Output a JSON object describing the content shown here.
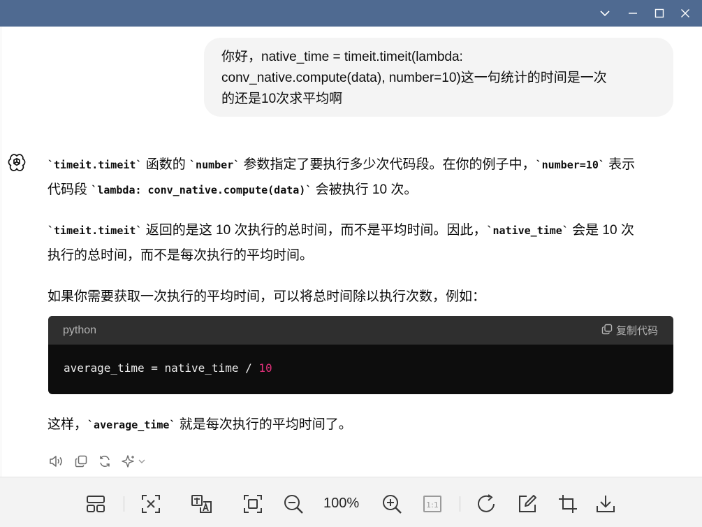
{
  "window": {
    "controls": [
      "chevron-down-icon",
      "minimize-icon",
      "maximize-icon",
      "close-icon"
    ]
  },
  "user_message": {
    "line1": "你好，native_time = timeit.timeit(lambda:",
    "line2": "conv_native.compute(data), number=10)这一句统计的时间是一次",
    "line3": "的还是10次求平均啊"
  },
  "assistant": {
    "p1": {
      "code1": "`timeit.timeit`",
      "t1": " 函数的 ",
      "code2": "`number`",
      "t2": " 参数指定了要执行多少次代码段。在你的例子中，",
      "code3": "`number=10`",
      "t3": " 表示",
      "t4": "代码段 ",
      "code4": "`lambda: conv_native.compute(data)`",
      "t5": " 会被执行 10 次。"
    },
    "p2": {
      "code1": "`timeit.timeit`",
      "t1": " 返回的是这 10 次执行的总时间，而不是平均时间。因此，",
      "code2": "`native_time`",
      "t2": " 会是 10 次",
      "t3": "执行的总时间，而不是每次执行的平均时间。"
    },
    "p3": "如果你需要获取一次执行的平均时间，可以将总时间除以执行次数，例如：",
    "codeblock": {
      "language": "python",
      "copy_label": "复制代码",
      "code_prefix": "average_time = native_time / ",
      "code_number": "10"
    },
    "p4": {
      "t1": "这样，",
      "code1": "`average_time`",
      "t2": " 就是每次执行的平均时间了。"
    }
  },
  "message_actions": [
    "speaker-icon",
    "copy-icon",
    "regenerate-icon",
    "sparkle-icon"
  ],
  "viewer_toolbar": {
    "zoom_level": "100%",
    "buttons": [
      "layout-icon",
      "fit-icon",
      "translate-icon",
      "fullscreen-icon",
      "zoom-out-icon",
      "zoom-in-icon",
      "actual-size-icon",
      "rotate-icon",
      "edit-icon",
      "crop-icon",
      "download-icon"
    ]
  }
}
